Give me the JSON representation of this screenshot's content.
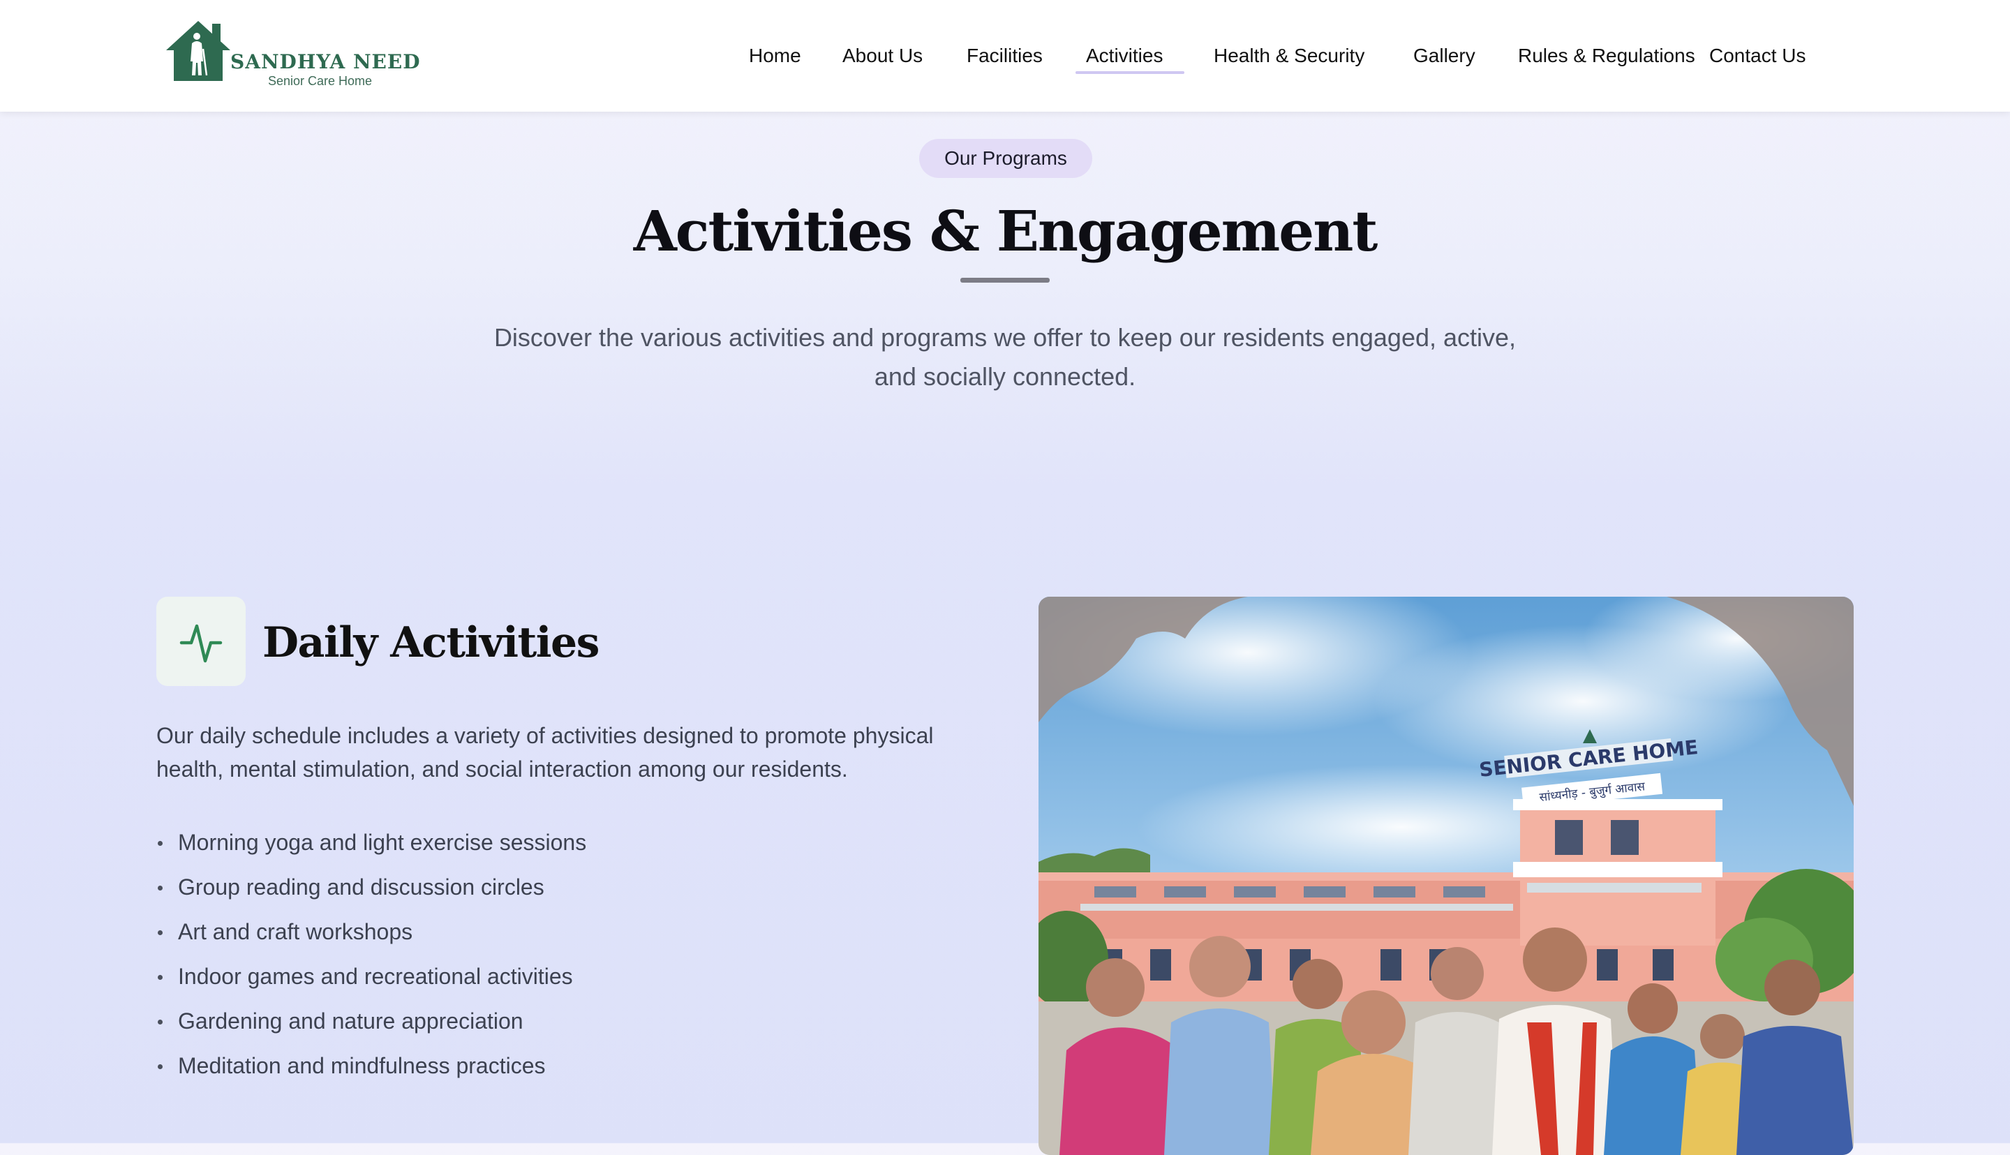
{
  "brand": {
    "name": "SANDHYA NEED",
    "tagline": "Senior Care Home",
    "color": "#2e6a50"
  },
  "nav": {
    "items": [
      {
        "label": "Home"
      },
      {
        "label": "About Us"
      },
      {
        "label": "Facilities"
      },
      {
        "label": "Activities",
        "active": true
      },
      {
        "label": "Health & Security"
      },
      {
        "label": "Gallery"
      },
      {
        "label": "Rules & Regulations"
      },
      {
        "label": "Contact Us"
      }
    ],
    "active_color": "#cfc7f2"
  },
  "hero": {
    "badge": "Our Programs",
    "title": "Activities & Engagement",
    "description": "Discover the various activities and programs we offer to keep our residents engaged, active, and socially connected."
  },
  "daily": {
    "icon": "activity-pulse-icon",
    "title": "Daily Activities",
    "description": "Our daily schedule includes a variety of activities designed to promote physical health, mental stimulation, and social interaction among our residents.",
    "items": [
      "Morning yoga and light exercise sessions",
      "Group reading and discussion circles",
      "Art and craft workshops",
      "Indoor games and recreational activities",
      "Gardening and nature appreciation",
      "Meditation and mindfulness practices"
    ],
    "photo": {
      "building_sign": "SENIOR CARE HOME",
      "building_subsign": "सांध्यनीड़ - बुजुर्ग आवास"
    }
  },
  "colors": {
    "accent_green": "#2f8a55",
    "pill_bg": "#e3dcf7",
    "heading": "#0e0e14"
  }
}
